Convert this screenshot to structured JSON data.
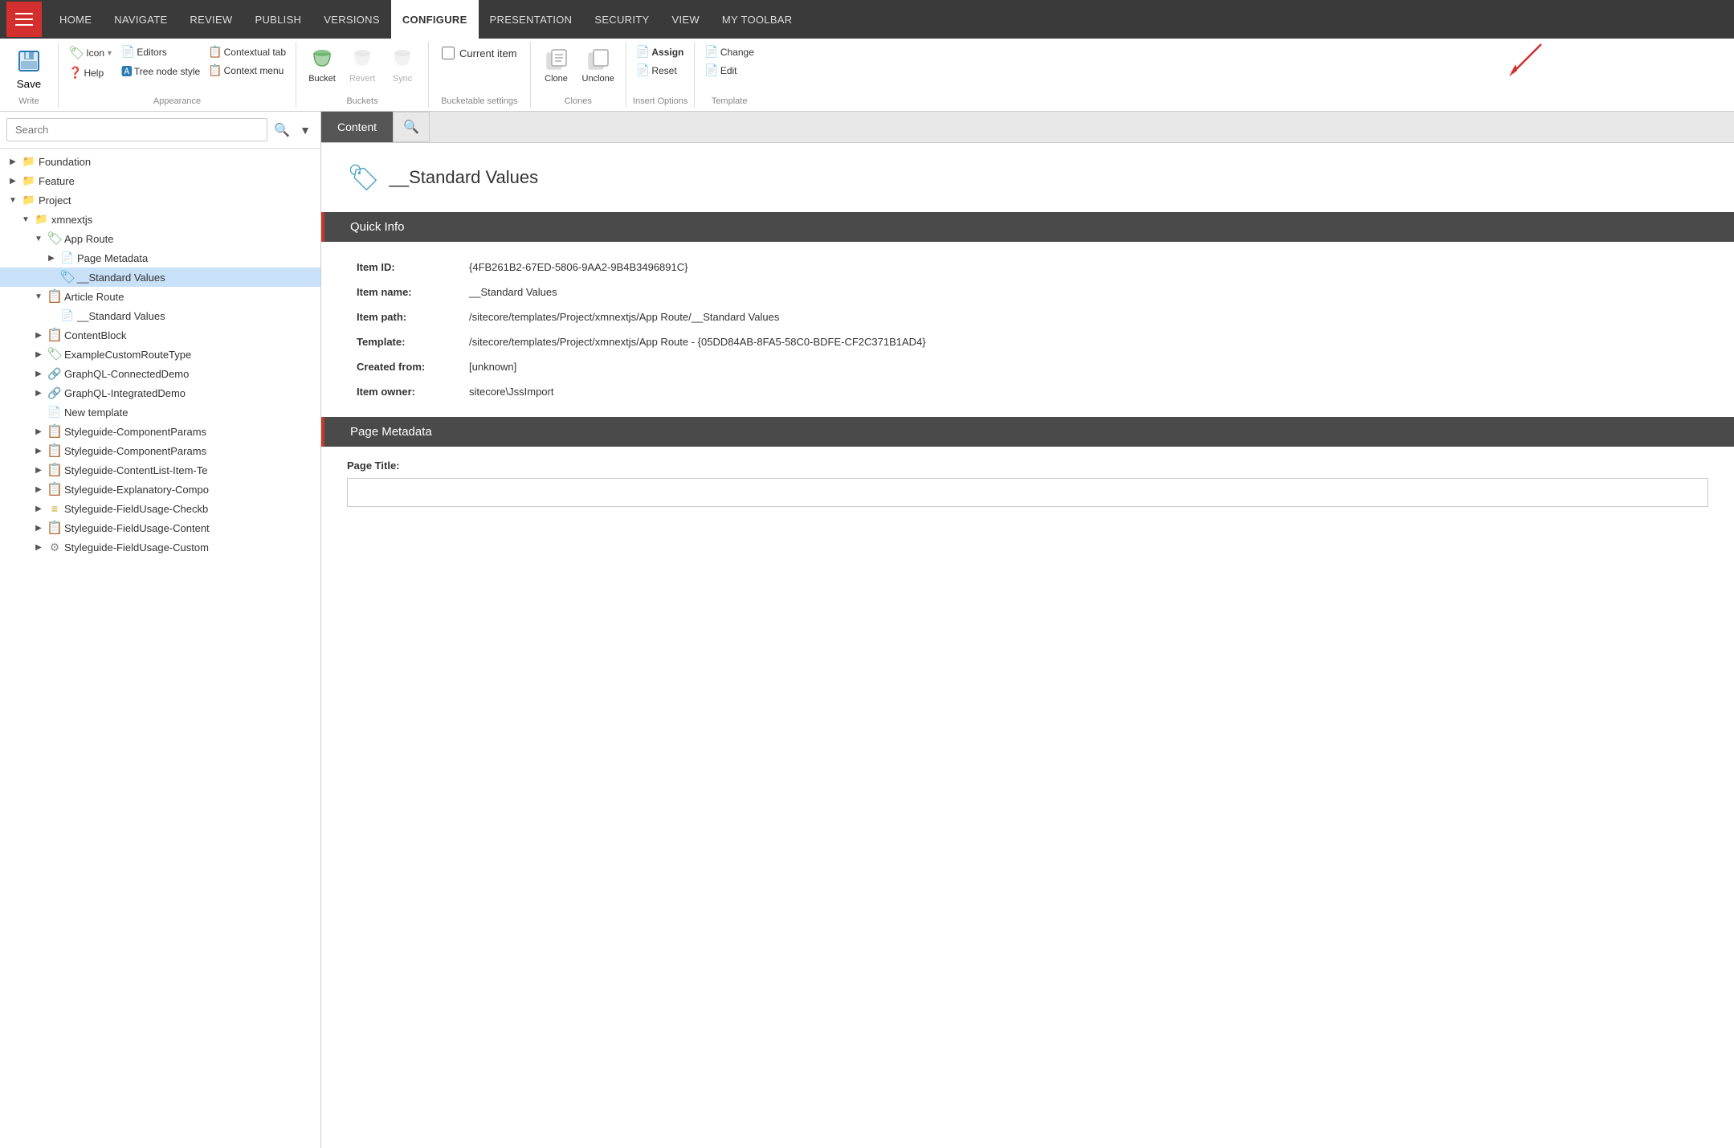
{
  "nav": {
    "items": [
      {
        "label": "HOME",
        "active": false
      },
      {
        "label": "NAVIGATE",
        "active": false
      },
      {
        "label": "REVIEW",
        "active": false
      },
      {
        "label": "PUBLISH",
        "active": false
      },
      {
        "label": "VERSIONS",
        "active": false
      },
      {
        "label": "CONFIGURE",
        "active": true
      },
      {
        "label": "PRESENTATION",
        "active": false
      },
      {
        "label": "SECURITY",
        "active": false
      },
      {
        "label": "VIEW",
        "active": false
      },
      {
        "label": "MY TOOLBAR",
        "active": false
      }
    ]
  },
  "ribbon": {
    "groups": {
      "write": {
        "label": "Write",
        "save_label": "Save"
      },
      "appearance": {
        "label": "Appearance",
        "icon_label": "Icon",
        "help_label": "Help",
        "editors_label": "Editors",
        "tree_node_label": "Tree node style",
        "contextual_tab_label": "Contextual tab",
        "context_menu_label": "Context menu"
      },
      "buckets": {
        "label": "Buckets",
        "bucket_label": "Bucket",
        "revert_label": "Revert",
        "sync_label": "Sync"
      },
      "bucketable": {
        "label": "Bucketable settings"
      },
      "current_item_label": "Current item",
      "clones": {
        "label": "Clones",
        "clone_label": "Clone",
        "unclone_label": "Unclone"
      },
      "insert_options": {
        "label": "Insert Options",
        "assign_label": "Assign",
        "reset_label": "Reset"
      },
      "template": {
        "label": "Template",
        "change_label": "Change",
        "edit_label": "Edit"
      }
    }
  },
  "search": {
    "placeholder": "Search",
    "value": ""
  },
  "tree": {
    "items": [
      {
        "id": "foundation",
        "label": "Foundation",
        "indent": 1,
        "expanded": false,
        "type": "folder"
      },
      {
        "id": "feature",
        "label": "Feature",
        "indent": 1,
        "expanded": false,
        "type": "folder"
      },
      {
        "id": "project",
        "label": "Project",
        "indent": 1,
        "expanded": true,
        "type": "folder"
      },
      {
        "id": "xmnextjs",
        "label": "xmnextjs",
        "indent": 2,
        "expanded": true,
        "type": "folder"
      },
      {
        "id": "app-route",
        "label": "App Route",
        "indent": 3,
        "expanded": true,
        "type": "template"
      },
      {
        "id": "page-metadata",
        "label": "Page Metadata",
        "indent": 4,
        "expanded": false,
        "type": "page"
      },
      {
        "id": "standard-values-1",
        "label": "__Standard Values",
        "indent": 4,
        "expanded": false,
        "type": "standard",
        "selected": true
      },
      {
        "id": "article-route",
        "label": "Article Route",
        "indent": 3,
        "expanded": true,
        "type": "template"
      },
      {
        "id": "standard-values-2",
        "label": "__Standard Values",
        "indent": 4,
        "expanded": false,
        "type": "page"
      },
      {
        "id": "contentblock",
        "label": "ContentBlock",
        "indent": 3,
        "expanded": false,
        "type": "template"
      },
      {
        "id": "example-custom",
        "label": "ExampleCustomRouteType",
        "indent": 3,
        "expanded": false,
        "type": "template"
      },
      {
        "id": "graphql-connected",
        "label": "GraphQL-ConnectedDemo",
        "indent": 3,
        "expanded": false,
        "type": "link"
      },
      {
        "id": "graphql-integrated",
        "label": "GraphQL-IntegratedDemo",
        "indent": 3,
        "expanded": false,
        "type": "link"
      },
      {
        "id": "new-template",
        "label": "New template",
        "indent": 3,
        "expanded": false,
        "type": "page"
      },
      {
        "id": "styleguide-component1",
        "label": "Styleguide-ComponentParams",
        "indent": 3,
        "expanded": false,
        "type": "template"
      },
      {
        "id": "styleguide-component2",
        "label": "Styleguide-ComponentParams",
        "indent": 3,
        "expanded": false,
        "type": "template"
      },
      {
        "id": "styleguide-contentlist",
        "label": "Styleguide-ContentList-Item-Te",
        "indent": 3,
        "expanded": false,
        "type": "template"
      },
      {
        "id": "styleguide-explanatory",
        "label": "Styleguide-Explanatory-Compo",
        "indent": 3,
        "expanded": false,
        "type": "template"
      },
      {
        "id": "styleguide-fieldusage-check",
        "label": "Styleguide-FieldUsage-Checkb",
        "indent": 3,
        "expanded": false,
        "type": "field"
      },
      {
        "id": "styleguide-fieldusage-content",
        "label": "Styleguide-FieldUsage-Content",
        "indent": 3,
        "expanded": false,
        "type": "template"
      },
      {
        "id": "styleguide-fieldusage-custom",
        "label": "Styleguide-FieldUsage-Custom",
        "indent": 3,
        "expanded": false,
        "type": "gear"
      }
    ]
  },
  "content": {
    "tabs": [
      {
        "label": "Content",
        "active": true
      },
      {
        "label": "Search",
        "active": false
      }
    ],
    "item": {
      "title": "__Standard Values",
      "quick_info_label": "Quick Info",
      "page_metadata_label": "Page Metadata",
      "page_title_label": "Page Title:",
      "fields": {
        "item_id_label": "Item ID:",
        "item_id_value": "{4FB261B2-67ED-5806-9AA2-9B4B3496891C}",
        "item_name_label": "Item name:",
        "item_name_value": "__Standard Values",
        "item_path_label": "Item path:",
        "item_path_value": "/sitecore/templates/Project/xmnextjs/App Route/__Standard Values",
        "template_label": "Template:",
        "template_value": "/sitecore/templates/Project/xmnextjs/App Route - {05DD84AB-8FA5-58C0-BDFE-CF2C371B1AD4}",
        "created_from_label": "Created from:",
        "created_from_value": "[unknown]",
        "item_owner_label": "Item owner:",
        "item_owner_value": "sitecore\\JssImport"
      }
    }
  }
}
